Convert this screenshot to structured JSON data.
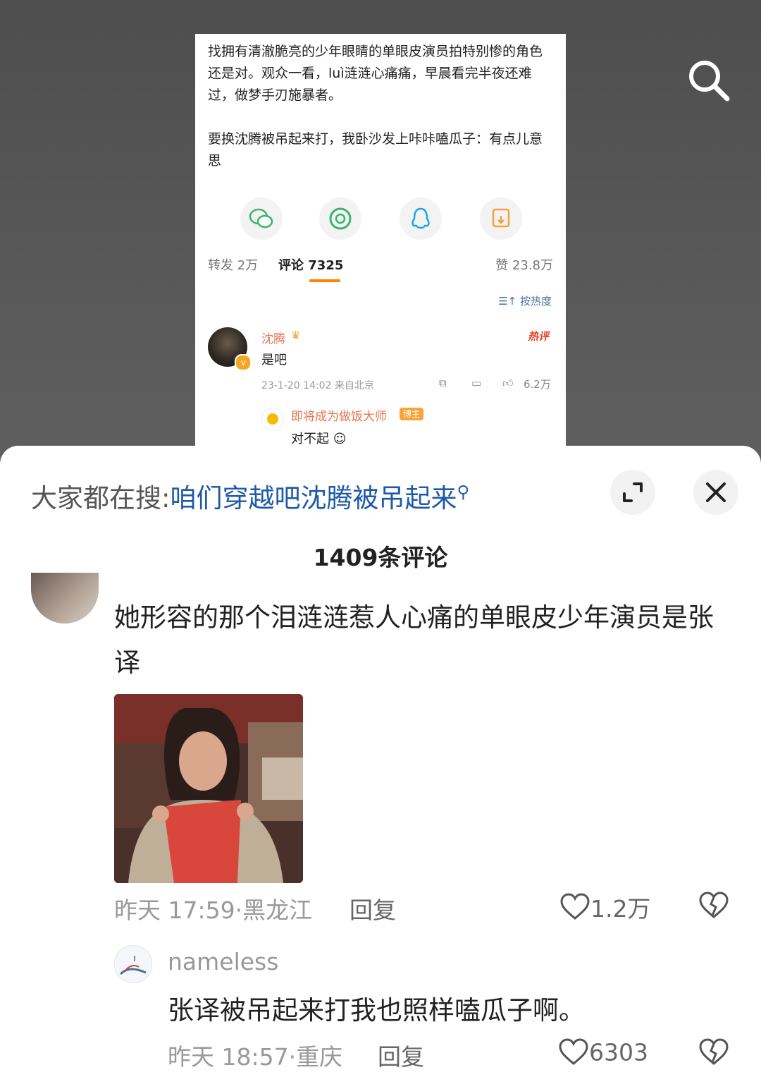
{
  "video": {
    "post": {
      "text": "找拥有清澈脆亮的少年眼睛的单眼皮演员拍特别惨的角色还是对。观众一看，luì涟涟心痛痛，早晨看完半夜还难过，做梦手刃施暴者。\n\n要换沈腾被吊起来打，我卧沙发上咔咔嗑瓜子：有点儿意思",
      "share_icons": [
        "wechat-icon",
        "moments-icon",
        "qq-icon",
        "save-image-icon"
      ],
      "stats": {
        "repost": "转发 2万",
        "comment": "评论 7325",
        "like": "赞 23.8万"
      },
      "sort_label": "按热度",
      "top_comment": {
        "user": "沈腾",
        "hot_tag": "热评",
        "text": "是吧",
        "meta": "23-1-20 14:02 来自北京",
        "likes": "6.2万"
      },
      "reply": {
        "user": "即将成为做饭大师",
        "badge": "博主",
        "text": "对不起"
      }
    }
  },
  "sheet": {
    "hot_search_label": "大家都在搜:",
    "hot_search_term": "咱们穿越吧沈腾被吊起来",
    "comment_count": "1409条评论",
    "comments": [
      {
        "text": "她形容的那个泪涟涟惹人心痛的单眼皮少年演员是张译",
        "meta": "昨天 17:59·黑龙江",
        "reply_label": "回复",
        "likes": "1.2万"
      },
      {
        "user": "nameless",
        "text": "张译被吊起来打我也照样嗑瓜子啊。",
        "meta": "昨天 18:57·重庆",
        "reply_label": "回复",
        "likes": "6303"
      }
    ]
  },
  "colors": {
    "accent_orange": "#ff8200",
    "link_blue": "#1e5aa8",
    "username_orange": "#eb7350"
  }
}
